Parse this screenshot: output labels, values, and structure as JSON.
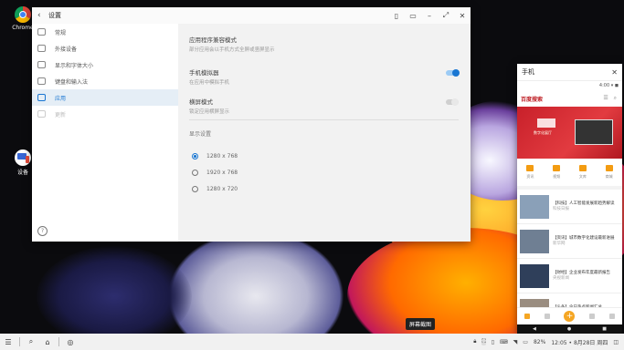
{
  "desktop": {
    "icons": [
      {
        "label": "Chrome"
      },
      {
        "label": "设备"
      }
    ]
  },
  "settings": {
    "title": "设置",
    "sidebar": [
      {
        "label": "常规"
      },
      {
        "label": "外接设备"
      },
      {
        "label": "显示和字体大小"
      },
      {
        "label": "键盘和输入法"
      },
      {
        "label": "应用"
      },
      {
        "label": "更新"
      }
    ],
    "rows": [
      {
        "title": "应用程序兼容模式",
        "subtitle": "部分应用会以手机方式全屏或竖屏显示"
      },
      {
        "title": "手机模拟器",
        "subtitle": "在应用中模拟手机"
      },
      {
        "title": "横屏模式",
        "subtitle": "锁定应用横屏显示"
      }
    ],
    "section_label": "显示设置",
    "radios": [
      {
        "label": "1280 x 768",
        "selected": true
      },
      {
        "label": "1920 x 768",
        "selected": false
      },
      {
        "label": "1280 x 720",
        "selected": false
      }
    ]
  },
  "phone": {
    "title": "手机",
    "status": "4:00 ▾ ◼",
    "app_name": "百度搜索",
    "app_icons": "☰ ⌕",
    "banner_text": "数字化展厅",
    "quick": [
      {
        "label": "资讯"
      },
      {
        "label": "视频"
      },
      {
        "label": "文库"
      },
      {
        "label": "商城"
      }
    ],
    "news": [
      {
        "text": "【科技】人工智能发展新趋势解读",
        "meta": "科技日报"
      },
      {
        "text": "【资讯】城市数字化建设最新进展",
        "meta": "新华网"
      },
      {
        "text": "【财经】企业发布年度最新报告",
        "meta": "央视新闻"
      },
      {
        "text": "【头条】今日热点新闻汇总",
        "meta": "人民网"
      }
    ]
  },
  "tooltip": "屏幕截图",
  "taskbar": {
    "clock": "12:05 • 8月28日 周四",
    "battery": "82%"
  }
}
